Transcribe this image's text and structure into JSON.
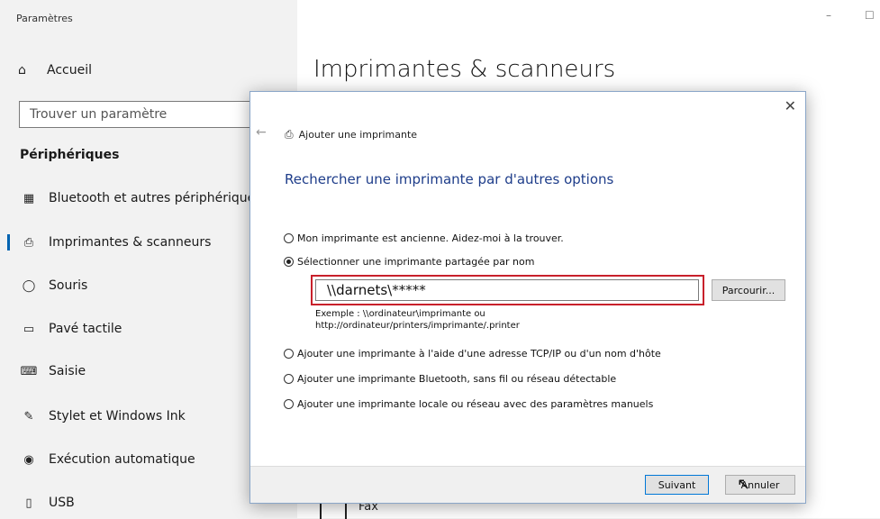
{
  "window": {
    "title": "Paramètres",
    "minimize_glyph": "–",
    "maximize_glyph": "☐"
  },
  "sidebar": {
    "home_icon": "home-icon",
    "home_label": "Accueil",
    "search_placeholder": "Trouver un paramètre",
    "section_title": "Périphériques",
    "items": [
      {
        "icon": "bluetooth-devices-icon",
        "glyph": "▦",
        "label": "Bluetooth et autres périphériques"
      },
      {
        "icon": "printer-icon",
        "glyph": "⎙",
        "label": "Imprimantes & scanneurs"
      },
      {
        "icon": "mouse-icon",
        "glyph": "◯",
        "label": "Souris"
      },
      {
        "icon": "touchpad-icon",
        "glyph": "▭",
        "label": "Pavé tactile"
      },
      {
        "icon": "keyboard-icon",
        "glyph": "⌨",
        "label": "Saisie"
      },
      {
        "icon": "pen-icon",
        "glyph": "✎",
        "label": "Stylet et Windows Ink"
      },
      {
        "icon": "autoplay-icon",
        "glyph": "◉",
        "label": "Exécution automatique"
      },
      {
        "icon": "usb-icon",
        "glyph": "▯",
        "label": "USB"
      }
    ]
  },
  "main": {
    "heading": "Imprimantes & scanneurs",
    "fax_label": "Fax"
  },
  "dialog": {
    "close_glyph": "✕",
    "back_glyph": "←",
    "title": "Ajouter une imprimante",
    "heading": "Rechercher une imprimante par d'autres options",
    "options": [
      {
        "label": "Mon imprimante est ancienne. Aidez-moi à la trouver.",
        "checked": false
      },
      {
        "label": "Sélectionner une imprimante partagée par nom",
        "checked": true
      },
      {
        "label": "Ajouter une imprimante à l'aide d'une adresse TCP/IP ou d'un nom d'hôte",
        "checked": false
      },
      {
        "label": "Ajouter une imprimante Bluetooth, sans fil ou réseau détectable",
        "checked": false
      },
      {
        "label": "Ajouter une imprimante locale ou réseau avec des paramètres manuels",
        "checked": false
      }
    ],
    "name_value": "\\\\darnets\\*****",
    "browse_label": "Parcourir...",
    "example_line1": "Exemple : \\\\ordinateur\\imprimante ou",
    "example_line2": "http://ordinateur/printers/imprimante/.printer",
    "next_label": "Suivant",
    "cancel_label": "Annuler"
  },
  "colors": {
    "accent": "#0063b1",
    "heading_blue": "#1e3d8a",
    "highlight_red": "#c8202b"
  }
}
